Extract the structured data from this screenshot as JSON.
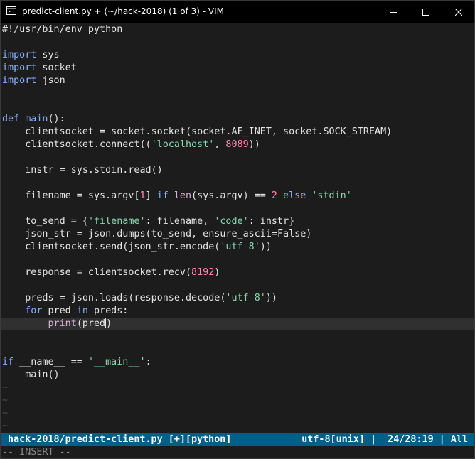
{
  "window": {
    "title": "predict-client.py + (~/hack-2018) (1 of 3) - VIM",
    "app_icon": "vim-terminal-icon",
    "controls": [
      "minimize",
      "maximize",
      "close"
    ]
  },
  "editor": {
    "lines": [
      "#!/usr/bin/env python",
      "",
      "import sys",
      "import socket",
      "import json",
      "",
      "",
      "def main():",
      "    clientsocket = socket.socket(socket.AF_INET, socket.SOCK_STREAM)",
      "    clientsocket.connect(('localhost', 8089))",
      "",
      "    instr = sys.stdin.read()",
      "",
      "    filename = sys.argv[1] if len(sys.argv) == 2 else 'stdin'",
      "",
      "    to_send = {'filename': filename, 'code': instr}",
      "    json_str = json.dumps(to_send, ensure_ascii=False)",
      "    clientsocket.send(json_str.encode('utf-8'))",
      "",
      "    response = clientsocket.recv(8192)",
      "",
      "    preds = json.loads(response.decode('utf-8'))",
      "    for pred in preds:",
      "        print(pred)",
      "",
      "",
      "if __name__ == '__main__':",
      "    main()",
      "~",
      "~",
      "~",
      "~"
    ],
    "cursor_line": 24
  },
  "statusline": {
    "left": "hack-2018/predict-client.py [+][python]",
    "right": "utf-8[unix] |  24/28:19 | All"
  },
  "cmdline": {
    "mode": "-- INSERT --"
  },
  "colors": {
    "background": "#1c1c1c",
    "keyword": "#87afff",
    "string": "#87d7af",
    "number": "#ff87af",
    "statusline": "#005f87"
  }
}
